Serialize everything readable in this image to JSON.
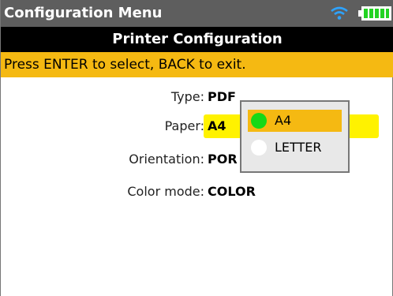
{
  "window": {
    "title": "Configuration Menu"
  },
  "status": {
    "wifi_icon": "wifi-icon",
    "battery_icon": "battery-full-icon"
  },
  "header": {
    "title": "Printer Configuration"
  },
  "hint": {
    "text": "Press ENTER to select, BACK to exit."
  },
  "settings": [
    {
      "label": "Type:",
      "value": "PDF"
    },
    {
      "label": "Paper:",
      "value": "A4"
    },
    {
      "label": "Orientation:",
      "value": "POR"
    },
    {
      "label": "Color mode:",
      "value": "COLOR"
    }
  ],
  "popup": {
    "options": [
      {
        "label": "A4",
        "selected": true
      },
      {
        "label": "LETTER",
        "selected": false
      }
    ]
  },
  "colors": {
    "accent": "#f5b912",
    "field_highlight": "#fff200",
    "selected_dot": "#16d916"
  }
}
